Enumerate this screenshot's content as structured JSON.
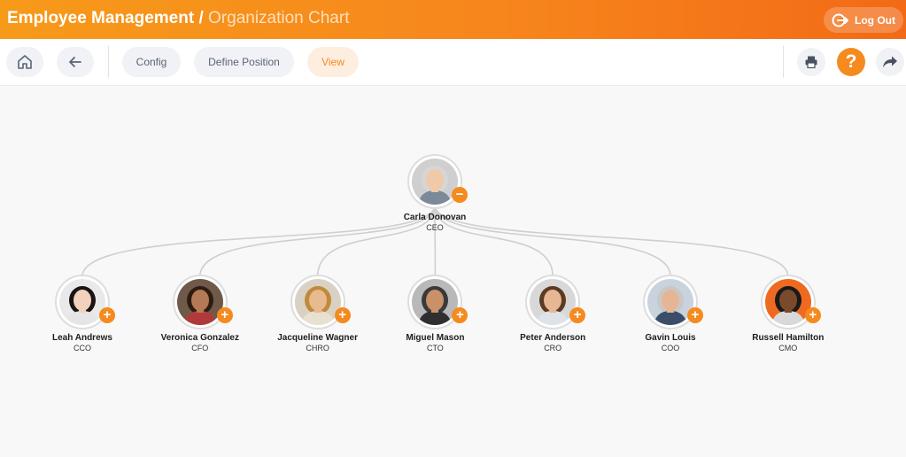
{
  "header": {
    "title_main": "Employee Management /",
    "title_sub": "Organization Chart",
    "logout_label": "Log Out"
  },
  "toolbar": {
    "home_icon": "home-icon",
    "back_icon": "arrow-left-icon",
    "tabs": [
      {
        "label": "Config",
        "active": false
      },
      {
        "label": "Define Position",
        "active": false
      },
      {
        "label": "View",
        "active": true
      }
    ],
    "print_icon": "printer-icon",
    "help_label": "?",
    "share_icon": "share-arrow-icon"
  },
  "colors": {
    "accent": "#f58a1f",
    "header_start": "#f79a1a",
    "header_end": "#f26a16",
    "link": "#cfcfcf"
  },
  "org": {
    "root": {
      "name": "Carla Donovan",
      "role": "CEO",
      "toggle": "−",
      "hair": "#d6d6d6",
      "skin": "#efc9a8",
      "bg": "#cfcfcf",
      "shirt": "#7a8a99"
    },
    "children": [
      {
        "name": "Leah Andrews",
        "role": "CCO",
        "toggle": "+",
        "hair": "#1a1414",
        "skin": "#f3d2bd",
        "bg": "#e9e9e9",
        "shirt": "#e5e5e5"
      },
      {
        "name": "Veronica Gonzalez",
        "role": "CFO",
        "toggle": "+",
        "hair": "#2e1c12",
        "skin": "#b47a55",
        "bg": "#6f5a4a",
        "shirt": "#b03a3a"
      },
      {
        "name": "Jacqueline Wagner",
        "role": "CHRO",
        "toggle": "+",
        "hair": "#c08a3a",
        "skin": "#e9b990",
        "bg": "#d9d2c4",
        "shirt": "#e8e0d0"
      },
      {
        "name": "Miguel Mason",
        "role": "CTO",
        "toggle": "+",
        "hair": "#3a3a3a",
        "skin": "#c9906a",
        "bg": "#b9b9b9",
        "shirt": "#2f2f2f"
      },
      {
        "name": "Peter Anderson",
        "role": "CRO",
        "toggle": "+",
        "hair": "#5b3b22",
        "skin": "#e7b694",
        "bg": "#d8d8d8",
        "shirt": "#dfe3e8"
      },
      {
        "name": "Gavin Louis",
        "role": "COO",
        "toggle": "+",
        "hair": "#c8c8c8",
        "skin": "#e6b596",
        "bg": "#c9d3dd",
        "shirt": "#3a4e6a"
      },
      {
        "name": "Russell Hamilton",
        "role": "CMO",
        "toggle": "+",
        "hair": "#1a1a1a",
        "skin": "#7a4a2c",
        "bg": "#ef6a21",
        "shirt": "#d9d9d9"
      }
    ]
  }
}
